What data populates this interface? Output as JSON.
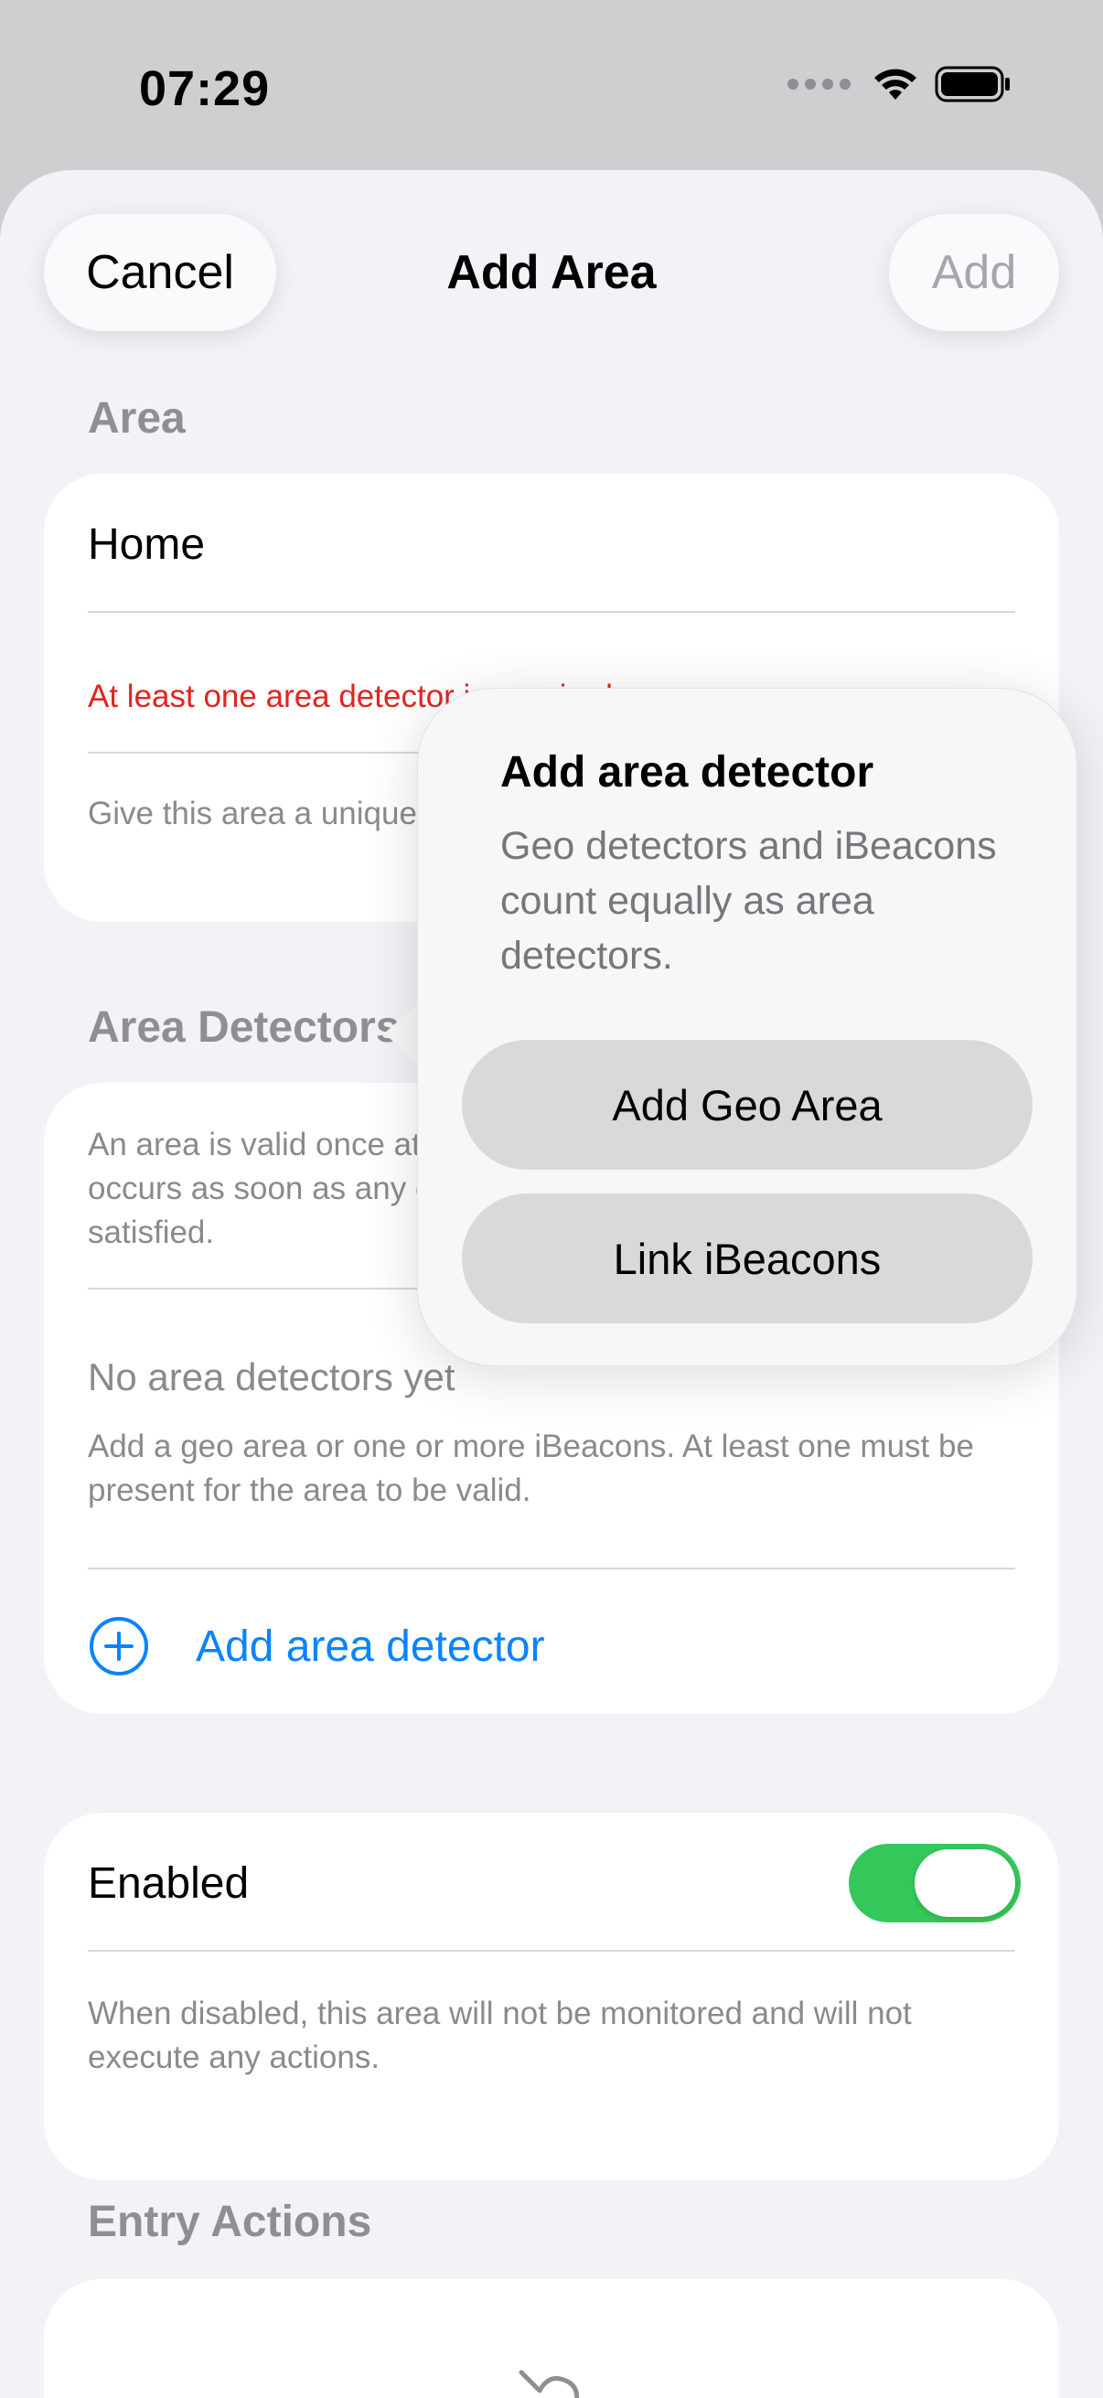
{
  "status_bar": {
    "time": "07:29"
  },
  "nav": {
    "cancel": "Cancel",
    "title": "Add Area",
    "add": "Add"
  },
  "area_section": {
    "header": "Area",
    "name_value": "Home",
    "error": "At least one area detector is required",
    "footer": "Give this area a unique name, e.g. “Home”, “Office” or “Gym”."
  },
  "detectors_section": {
    "header": "Area Detectors",
    "info": "An area is valid once at least one detector is configured. Entry occurs as soon as any detector is satisfied, exit when none are satisfied.",
    "empty_title": "No area detectors yet",
    "empty_body": "Add a geo area or one or more iBeacons. At least one must be present for the area to be valid.",
    "add_label": "Add area detector"
  },
  "enabled_section": {
    "label": "Enabled",
    "is_on": true,
    "footer": "When disabled, this area will not be monitored and will not execute any actions."
  },
  "entry_actions": {
    "header": "Entry Actions"
  },
  "popover": {
    "title": "Add area detector",
    "description": "Geo detectors and iBeacons count equally as area detectors.",
    "buttons": [
      "Add Geo Area",
      "Link iBeacons"
    ]
  },
  "colors": {
    "accent": "#0a84ff",
    "error": "#e0251f",
    "toggle_on": "#34c759"
  }
}
